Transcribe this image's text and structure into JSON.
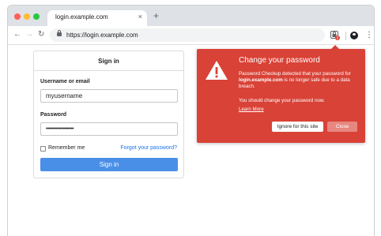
{
  "browser": {
    "tab_title": "login.example.com",
    "tab_close_glyph": "×",
    "new_tab_glyph": "+",
    "url": "https://login.example.com",
    "back_glyph": "←",
    "forward_glyph": "→",
    "reload_glyph": "↻",
    "menu_glyph": "⋮",
    "icons": [
      "back-icon",
      "forward-icon",
      "reload-icon",
      "lock-icon",
      "password-key-icon",
      "profile-icon",
      "menu-icon"
    ]
  },
  "signin": {
    "title": "Sign in",
    "username_label": "Username or email",
    "username_value": "myusername",
    "password_label": "Password",
    "password_value": "••••••••••••••••••",
    "remember_label": "Remember me",
    "forgot_link": "Forgot your password?",
    "submit_label": "Sign in"
  },
  "popup": {
    "title": "Change your password",
    "body_pre": "Password Checkup detected that your password for ",
    "body_site": "login.example.com",
    "body_post": " is no longer safe due to a data breach.",
    "body2": "You should change your password now.",
    "learn_more": "Learn More",
    "ignore_label": "Ignore for this site",
    "close_label": "Close",
    "color": "#d94237"
  },
  "colors": {
    "tabbar": "#dee1e6",
    "primary_button": "#4a8fe7",
    "link": "#1a73e8"
  }
}
